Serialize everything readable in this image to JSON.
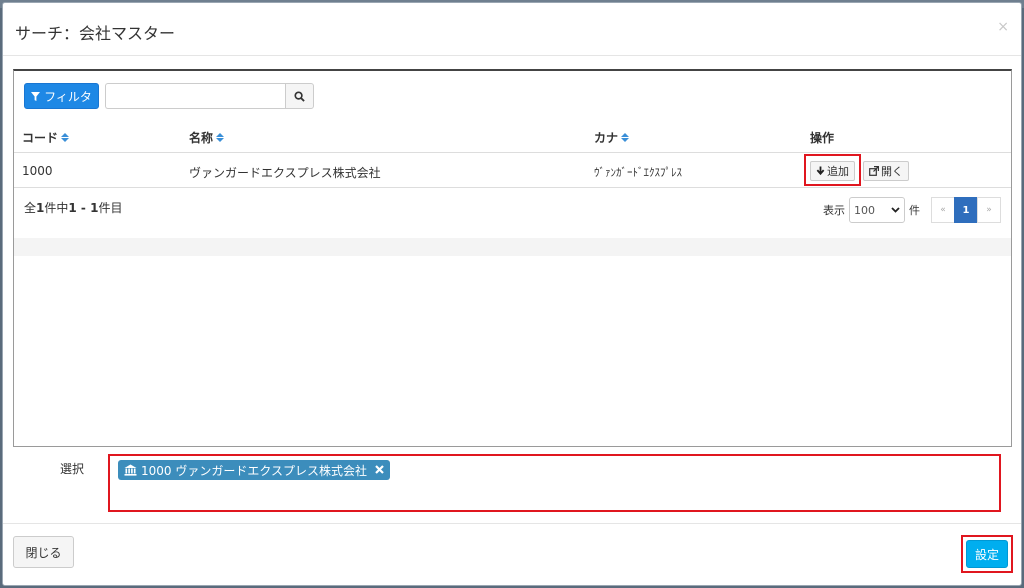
{
  "modal": {
    "title": "サーチ：会社マスター",
    "close_glyph": "×"
  },
  "toolbar": {
    "filter_label": "フィルタ",
    "search_placeholder": ""
  },
  "table": {
    "columns": [
      "コード",
      "名称",
      "カナ",
      "操作"
    ],
    "rows": [
      {
        "code": "1000",
        "name": "ヴァンガードエクスプレス株式会社",
        "kana": "ｳﾞｧﾝｶﾞｰﾄﾞｴｸｽﾌﾟﾚｽ",
        "add_label": "追加",
        "open_label": "開く"
      }
    ]
  },
  "summary": {
    "prefix": "全",
    "total": "1",
    "mid": "件中",
    "range": "1 - 1",
    "suffix": "件目"
  },
  "pagination": {
    "show_label": "表示",
    "page_size": "100",
    "unit_label": "件",
    "prev": "«",
    "current": "1",
    "next": "»"
  },
  "selection": {
    "label": "選択",
    "tag_text": "1000 ヴァンガードエクスプレス株式会社"
  },
  "footer": {
    "close_label": "閉じる",
    "set_label": "設定"
  },
  "colors": {
    "primary": "#1e88e5",
    "tag": "#3c8dbc",
    "set": "#00aeef",
    "highlight": "#e0161f",
    "page_active": "#2f6ebd"
  }
}
